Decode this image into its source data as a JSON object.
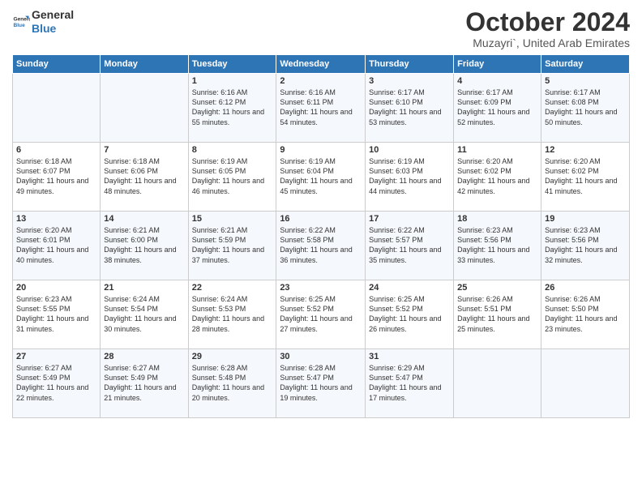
{
  "header": {
    "logo_line1": "General",
    "logo_line2": "Blue",
    "main_title": "October 2024",
    "subtitle": "Muzayri`, United Arab Emirates"
  },
  "days_of_week": [
    "Sunday",
    "Monday",
    "Tuesday",
    "Wednesday",
    "Thursday",
    "Friday",
    "Saturday"
  ],
  "weeks": [
    [
      {
        "day": "",
        "info": ""
      },
      {
        "day": "",
        "info": ""
      },
      {
        "day": "1",
        "info": "Sunrise: 6:16 AM\nSunset: 6:12 PM\nDaylight: 11 hours and 55 minutes."
      },
      {
        "day": "2",
        "info": "Sunrise: 6:16 AM\nSunset: 6:11 PM\nDaylight: 11 hours and 54 minutes."
      },
      {
        "day": "3",
        "info": "Sunrise: 6:17 AM\nSunset: 6:10 PM\nDaylight: 11 hours and 53 minutes."
      },
      {
        "day": "4",
        "info": "Sunrise: 6:17 AM\nSunset: 6:09 PM\nDaylight: 11 hours and 52 minutes."
      },
      {
        "day": "5",
        "info": "Sunrise: 6:17 AM\nSunset: 6:08 PM\nDaylight: 11 hours and 50 minutes."
      }
    ],
    [
      {
        "day": "6",
        "info": "Sunrise: 6:18 AM\nSunset: 6:07 PM\nDaylight: 11 hours and 49 minutes."
      },
      {
        "day": "7",
        "info": "Sunrise: 6:18 AM\nSunset: 6:06 PM\nDaylight: 11 hours and 48 minutes."
      },
      {
        "day": "8",
        "info": "Sunrise: 6:19 AM\nSunset: 6:05 PM\nDaylight: 11 hours and 46 minutes."
      },
      {
        "day": "9",
        "info": "Sunrise: 6:19 AM\nSunset: 6:04 PM\nDaylight: 11 hours and 45 minutes."
      },
      {
        "day": "10",
        "info": "Sunrise: 6:19 AM\nSunset: 6:03 PM\nDaylight: 11 hours and 44 minutes."
      },
      {
        "day": "11",
        "info": "Sunrise: 6:20 AM\nSunset: 6:02 PM\nDaylight: 11 hours and 42 minutes."
      },
      {
        "day": "12",
        "info": "Sunrise: 6:20 AM\nSunset: 6:02 PM\nDaylight: 11 hours and 41 minutes."
      }
    ],
    [
      {
        "day": "13",
        "info": "Sunrise: 6:20 AM\nSunset: 6:01 PM\nDaylight: 11 hours and 40 minutes."
      },
      {
        "day": "14",
        "info": "Sunrise: 6:21 AM\nSunset: 6:00 PM\nDaylight: 11 hours and 38 minutes."
      },
      {
        "day": "15",
        "info": "Sunrise: 6:21 AM\nSunset: 5:59 PM\nDaylight: 11 hours and 37 minutes."
      },
      {
        "day": "16",
        "info": "Sunrise: 6:22 AM\nSunset: 5:58 PM\nDaylight: 11 hours and 36 minutes."
      },
      {
        "day": "17",
        "info": "Sunrise: 6:22 AM\nSunset: 5:57 PM\nDaylight: 11 hours and 35 minutes."
      },
      {
        "day": "18",
        "info": "Sunrise: 6:23 AM\nSunset: 5:56 PM\nDaylight: 11 hours and 33 minutes."
      },
      {
        "day": "19",
        "info": "Sunrise: 6:23 AM\nSunset: 5:56 PM\nDaylight: 11 hours and 32 minutes."
      }
    ],
    [
      {
        "day": "20",
        "info": "Sunrise: 6:23 AM\nSunset: 5:55 PM\nDaylight: 11 hours and 31 minutes."
      },
      {
        "day": "21",
        "info": "Sunrise: 6:24 AM\nSunset: 5:54 PM\nDaylight: 11 hours and 30 minutes."
      },
      {
        "day": "22",
        "info": "Sunrise: 6:24 AM\nSunset: 5:53 PM\nDaylight: 11 hours and 28 minutes."
      },
      {
        "day": "23",
        "info": "Sunrise: 6:25 AM\nSunset: 5:52 PM\nDaylight: 11 hours and 27 minutes."
      },
      {
        "day": "24",
        "info": "Sunrise: 6:25 AM\nSunset: 5:52 PM\nDaylight: 11 hours and 26 minutes."
      },
      {
        "day": "25",
        "info": "Sunrise: 6:26 AM\nSunset: 5:51 PM\nDaylight: 11 hours and 25 minutes."
      },
      {
        "day": "26",
        "info": "Sunrise: 6:26 AM\nSunset: 5:50 PM\nDaylight: 11 hours and 23 minutes."
      }
    ],
    [
      {
        "day": "27",
        "info": "Sunrise: 6:27 AM\nSunset: 5:49 PM\nDaylight: 11 hours and 22 minutes."
      },
      {
        "day": "28",
        "info": "Sunrise: 6:27 AM\nSunset: 5:49 PM\nDaylight: 11 hours and 21 minutes."
      },
      {
        "day": "29",
        "info": "Sunrise: 6:28 AM\nSunset: 5:48 PM\nDaylight: 11 hours and 20 minutes."
      },
      {
        "day": "30",
        "info": "Sunrise: 6:28 AM\nSunset: 5:47 PM\nDaylight: 11 hours and 19 minutes."
      },
      {
        "day": "31",
        "info": "Sunrise: 6:29 AM\nSunset: 5:47 PM\nDaylight: 11 hours and 17 minutes."
      },
      {
        "day": "",
        "info": ""
      },
      {
        "day": "",
        "info": ""
      }
    ]
  ]
}
